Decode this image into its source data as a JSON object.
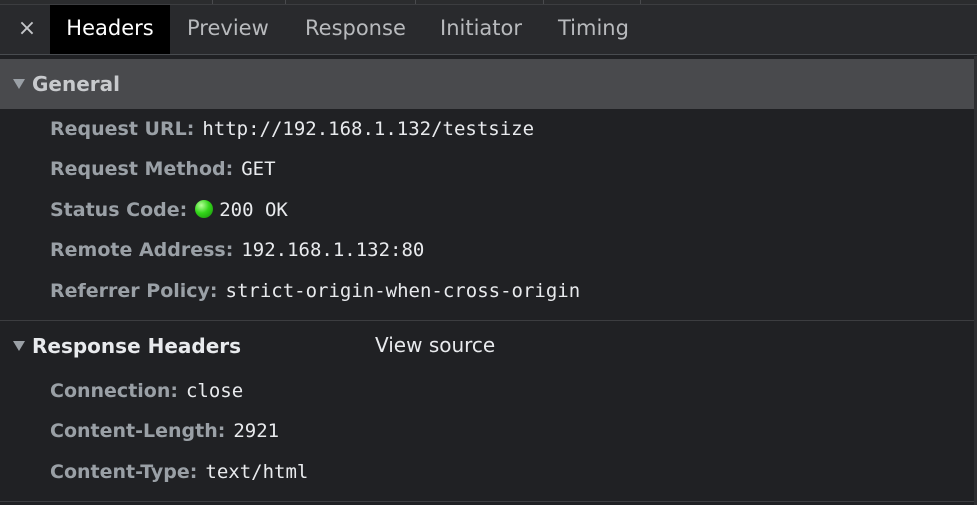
{
  "tabs": {
    "close_symbol": "×",
    "items": [
      {
        "label": "Headers",
        "active": true
      },
      {
        "label": "Preview",
        "active": false
      },
      {
        "label": "Response",
        "active": false
      },
      {
        "label": "Initiator",
        "active": false
      },
      {
        "label": "Timing",
        "active": false
      }
    ]
  },
  "general": {
    "title": "General",
    "rows": [
      {
        "key": "Request URL:",
        "value": "http://192.168.1.132/testsize"
      },
      {
        "key": "Request Method:",
        "value": "GET"
      },
      {
        "key": "Status Code:",
        "value": "200 OK",
        "status_color": "#33d61a"
      },
      {
        "key": "Remote Address:",
        "value": "192.168.1.132:80"
      },
      {
        "key": "Referrer Policy:",
        "value": "strict-origin-when-cross-origin"
      }
    ]
  },
  "response_headers": {
    "title": "Response Headers",
    "view_source": "View source",
    "rows": [
      {
        "key": "Connection:",
        "value": "close"
      },
      {
        "key": "Content-Length:",
        "value": "2921"
      },
      {
        "key": "Content-Type:",
        "value": "text/html"
      }
    ]
  }
}
